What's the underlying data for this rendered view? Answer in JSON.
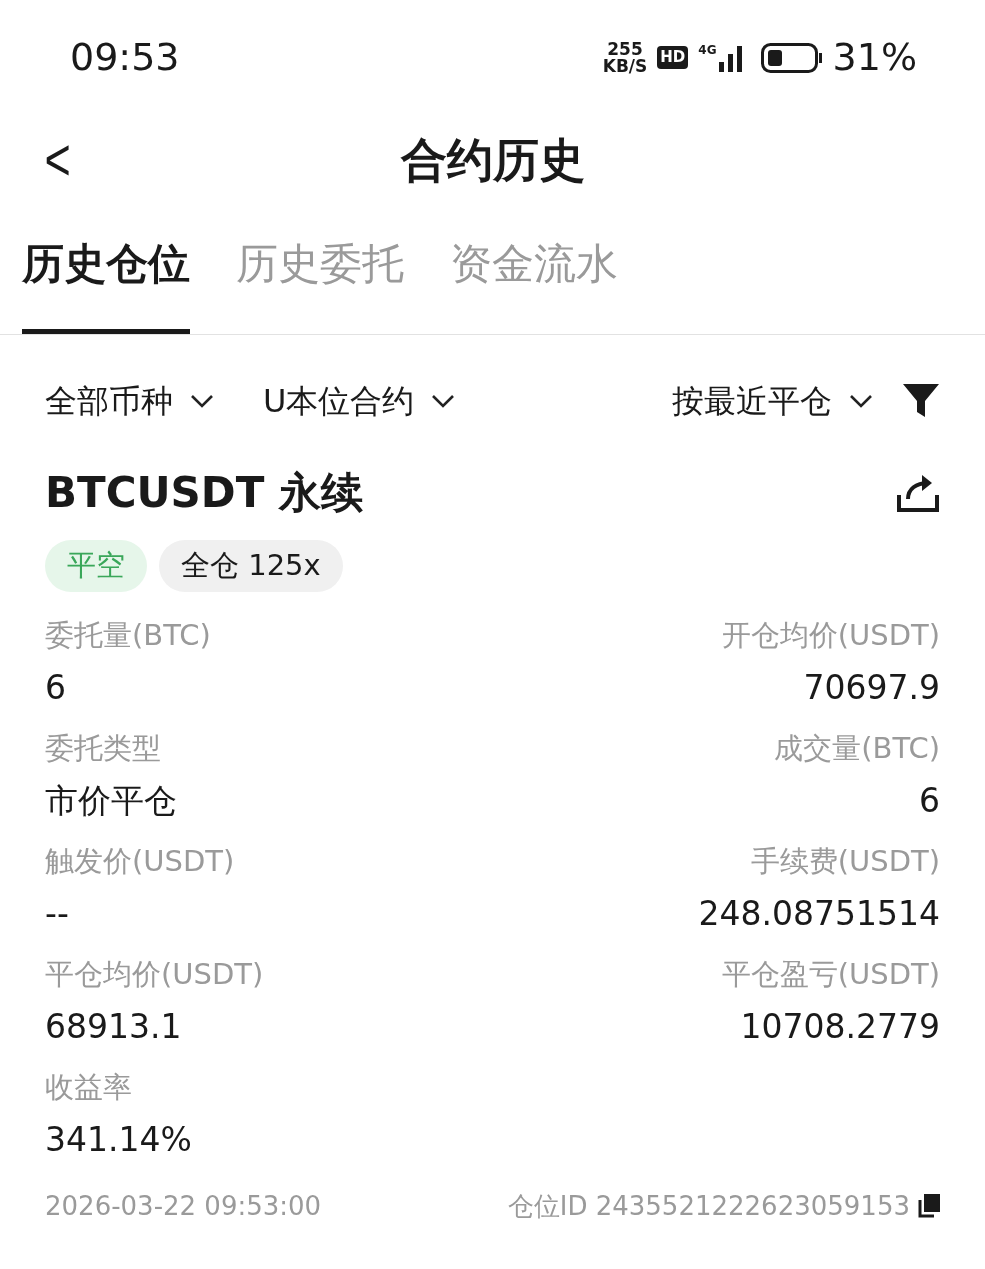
{
  "status_bar": {
    "time": "09:53",
    "speed_value": "255",
    "speed_unit": "KB/S",
    "hd": "HD",
    "network": "4G",
    "battery": "31%"
  },
  "header": {
    "back": "<",
    "title": "合约历史"
  },
  "tabs": [
    {
      "label": "历史仓位",
      "selected": true
    },
    {
      "label": "历史委托",
      "selected": false
    },
    {
      "label": "资金流水",
      "selected": false
    }
  ],
  "filters": [
    {
      "label": "全部币种"
    },
    {
      "label": "U本位合约"
    },
    {
      "label": "按最近平仓"
    }
  ],
  "record": {
    "symbol": "BTCUSDT 永续",
    "tags": [
      {
        "kind": "side",
        "label": "平空",
        "color": "#3aa75a"
      },
      {
        "kind": "margin",
        "label": "全仓 125x",
        "color": "#1a1a1a"
      }
    ],
    "fields": [
      {
        "label": "委托量(BTC)",
        "value": "6"
      },
      {
        "label": "开仓均价(USDT)",
        "value": "70697.9"
      },
      {
        "label": "委托类型",
        "value": "市价平仓"
      },
      {
        "label": "成交量(BTC)",
        "value": "6"
      },
      {
        "label": "触发价(USDT)",
        "value": "--"
      },
      {
        "label": "手续费(USDT)",
        "value": "248.08751514"
      },
      {
        "label": "平仓均价(USDT)",
        "value": "68913.1"
      },
      {
        "label": "平仓盈亏(USDT)",
        "value": "10708.2779"
      },
      {
        "label": "收益率",
        "value": "341.14%"
      }
    ],
    "time": "2026-03-22 09:53:00",
    "position_id": "仓位ID 2435521222623059153"
  }
}
